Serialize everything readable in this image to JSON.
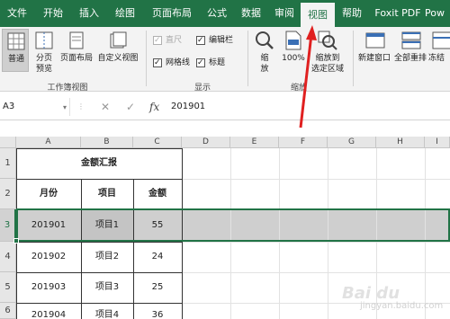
{
  "tabs": [
    {
      "label": "文件"
    },
    {
      "label": "开始"
    },
    {
      "label": "插入"
    },
    {
      "label": "绘图"
    },
    {
      "label": "页面布局"
    },
    {
      "label": "公式"
    },
    {
      "label": "数据"
    },
    {
      "label": "审阅"
    },
    {
      "label": "视图"
    },
    {
      "label": "帮助"
    },
    {
      "label": "Foxit PDF"
    },
    {
      "label": "Pow"
    }
  ],
  "ribbon": {
    "workbook_views": {
      "normal": "普通",
      "page_break_line1": "分页",
      "page_break_line2": "预览",
      "page_layout": "页面布局",
      "custom_views": "自定义视图",
      "group_label": "工作簿视图"
    },
    "show": {
      "ruler": "直尺",
      "formula_bar": "编辑栏",
      "gridlines": "网格线",
      "headings": "标题",
      "group_label": "显示"
    },
    "zoom": {
      "zoom_line1": "缩",
      "zoom_line2": "放",
      "percent": "100%",
      "zoom_sel_line1": "缩放到",
      "zoom_sel_line2": "选定区域",
      "group_label": "缩放"
    },
    "window": {
      "new_window": "新建窗口",
      "arrange_all": "全部重排",
      "freeze": "冻结"
    }
  },
  "formula_bar": {
    "name_box": "A3",
    "fx": "fx",
    "cancel": "✕",
    "enter": "✓",
    "value": "201901"
  },
  "columns": [
    "A",
    "B",
    "C",
    "D",
    "E",
    "F",
    "G",
    "H",
    "I"
  ],
  "rows": [
    "1",
    "2",
    "3",
    "4",
    "5",
    "6"
  ],
  "sheet": {
    "title": "金额汇报",
    "headers": [
      "月份",
      "项目",
      "金额"
    ],
    "data": [
      [
        "201901",
        "项目1",
        "55"
      ],
      [
        "201902",
        "项目2",
        "24"
      ],
      [
        "201903",
        "项目3",
        "25"
      ],
      [
        "201904",
        "项目4",
        "36"
      ]
    ]
  },
  "watermark": {
    "text": "Bai du",
    "sub": "jingyan.baidu.com"
  },
  "colors": {
    "accent": "#217346",
    "selected_row": "#cfcfcf",
    "annotation_arrow": "#e02020"
  }
}
